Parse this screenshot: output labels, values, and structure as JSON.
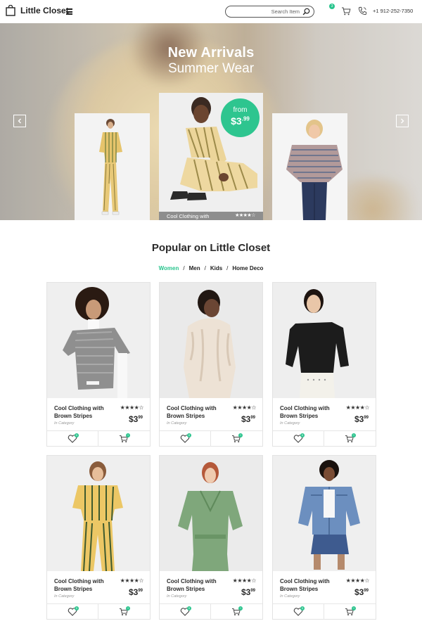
{
  "header": {
    "brand": "Little Closet",
    "search_placeholder": "Search Item",
    "cart_badge": "3",
    "phone": "+1 912-252-7350"
  },
  "hero": {
    "title": "New Arrivals",
    "subtitle": "Summer Wear",
    "price_from_label": "from",
    "price_main": "$3",
    "price_cents": ".99",
    "featured_caption": "Cool Clothing with",
    "featured_stars": "★★★★☆"
  },
  "popular": {
    "title": "Popular on Little Closet",
    "filters": [
      "Women",
      "Men",
      "Kids",
      "Home Deco"
    ],
    "active_filter": "Women",
    "separator": "/"
  },
  "products": [
    {
      "name": "Cool Clothing with Brown Stripes",
      "category": "In Category",
      "price": "$3",
      "cents": "99",
      "stars": "★★★★☆",
      "fav_badge": "0",
      "cart_badge": "+"
    },
    {
      "name": "Cool Clothing with Brown Stripes",
      "category": "In Category",
      "price": "$3",
      "cents": "99",
      "stars": "★★★★☆",
      "fav_badge": "0",
      "cart_badge": "+"
    },
    {
      "name": "Cool Clothing with Brown Stripes",
      "category": "In Category",
      "price": "$3",
      "cents": "99",
      "stars": "★★★★☆",
      "fav_badge": "0",
      "cart_badge": "+"
    },
    {
      "name": "Cool Clothing with Brown Stripes",
      "category": "In Category",
      "price": "$3",
      "cents": "99",
      "stars": "★★★★☆",
      "fav_badge": "0",
      "cart_badge": "+"
    },
    {
      "name": "Cool Clothing with Brown Stripes",
      "category": "In Category",
      "price": "$3",
      "cents": "99",
      "stars": "★★★★☆",
      "fav_badge": "0",
      "cart_badge": "+"
    },
    {
      "name": "Cool Clothing with Brown Stripes",
      "category": "In Category",
      "price": "$3",
      "cents": "99",
      "stars": "★★★★☆",
      "fav_badge": "0",
      "cart_badge": "+"
    }
  ],
  "colors": {
    "accent": "#2ec58f",
    "text": "#222222",
    "card_border": "#e3e3e3"
  }
}
